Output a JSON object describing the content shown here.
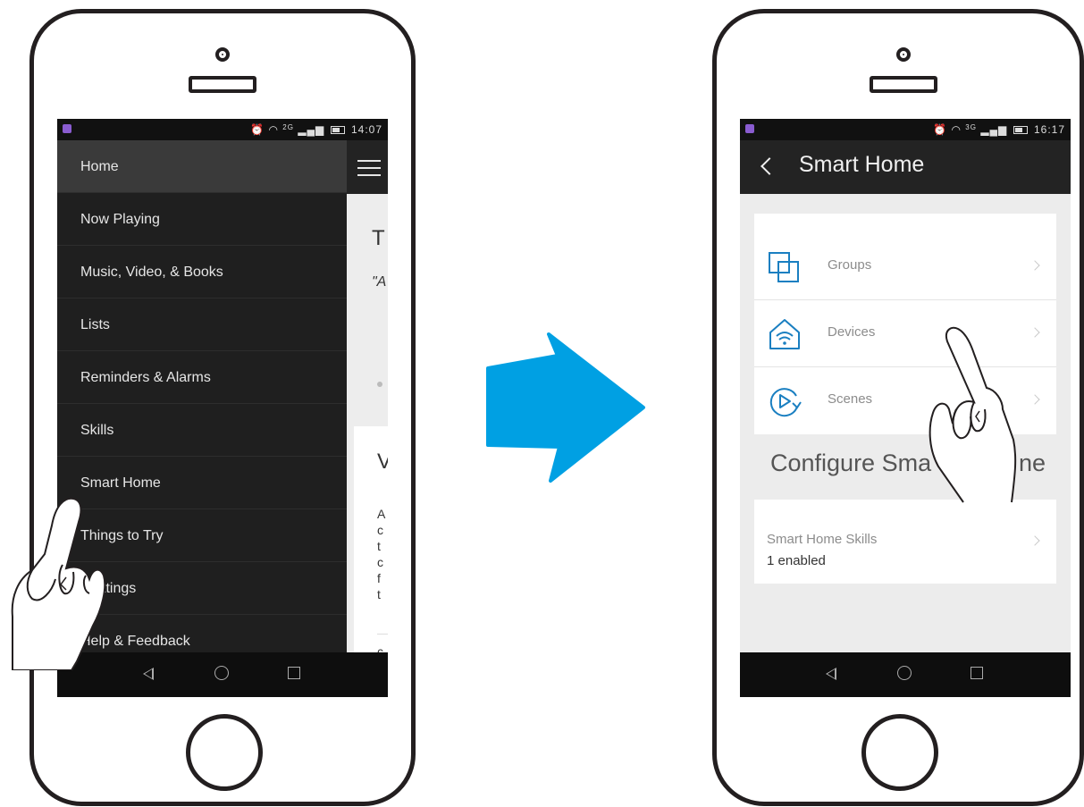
{
  "left_phone": {
    "status_time": "14:07",
    "network_label": "2G",
    "menu_items": [
      {
        "label": "Home"
      },
      {
        "label": "Now Playing"
      },
      {
        "label": "Music, Video, & Books"
      },
      {
        "label": "Lists"
      },
      {
        "label": "Reminders & Alarms"
      },
      {
        "label": "Skills"
      },
      {
        "label": "Smart Home"
      },
      {
        "label": "Things to Try"
      },
      {
        "label": "ttings"
      },
      {
        "label": "Help & Feedback"
      }
    ],
    "behind_fragments": [
      "T",
      "\"A",
      "V",
      "A",
      "c",
      "t",
      "c",
      "f",
      "t",
      "c"
    ]
  },
  "right_phone": {
    "status_time": "16:17",
    "network_label": "3G",
    "header_title": "Smart Home",
    "rows": [
      {
        "label": "Groups",
        "icon": "groups-icon"
      },
      {
        "label": "Devices",
        "icon": "devices-icon"
      },
      {
        "label": "Scenes",
        "icon": "scenes-icon"
      }
    ],
    "section_title": "Configure Sma",
    "section_title_tail": "ne",
    "skill_title": "Smart Home Skills",
    "skill_status": "1 enabled"
  },
  "colors": {
    "arrow": "#00a0e3",
    "accent_icon": "#1a7fc1",
    "menu_bg": "#1f1f1f",
    "outline": "#231f20"
  }
}
